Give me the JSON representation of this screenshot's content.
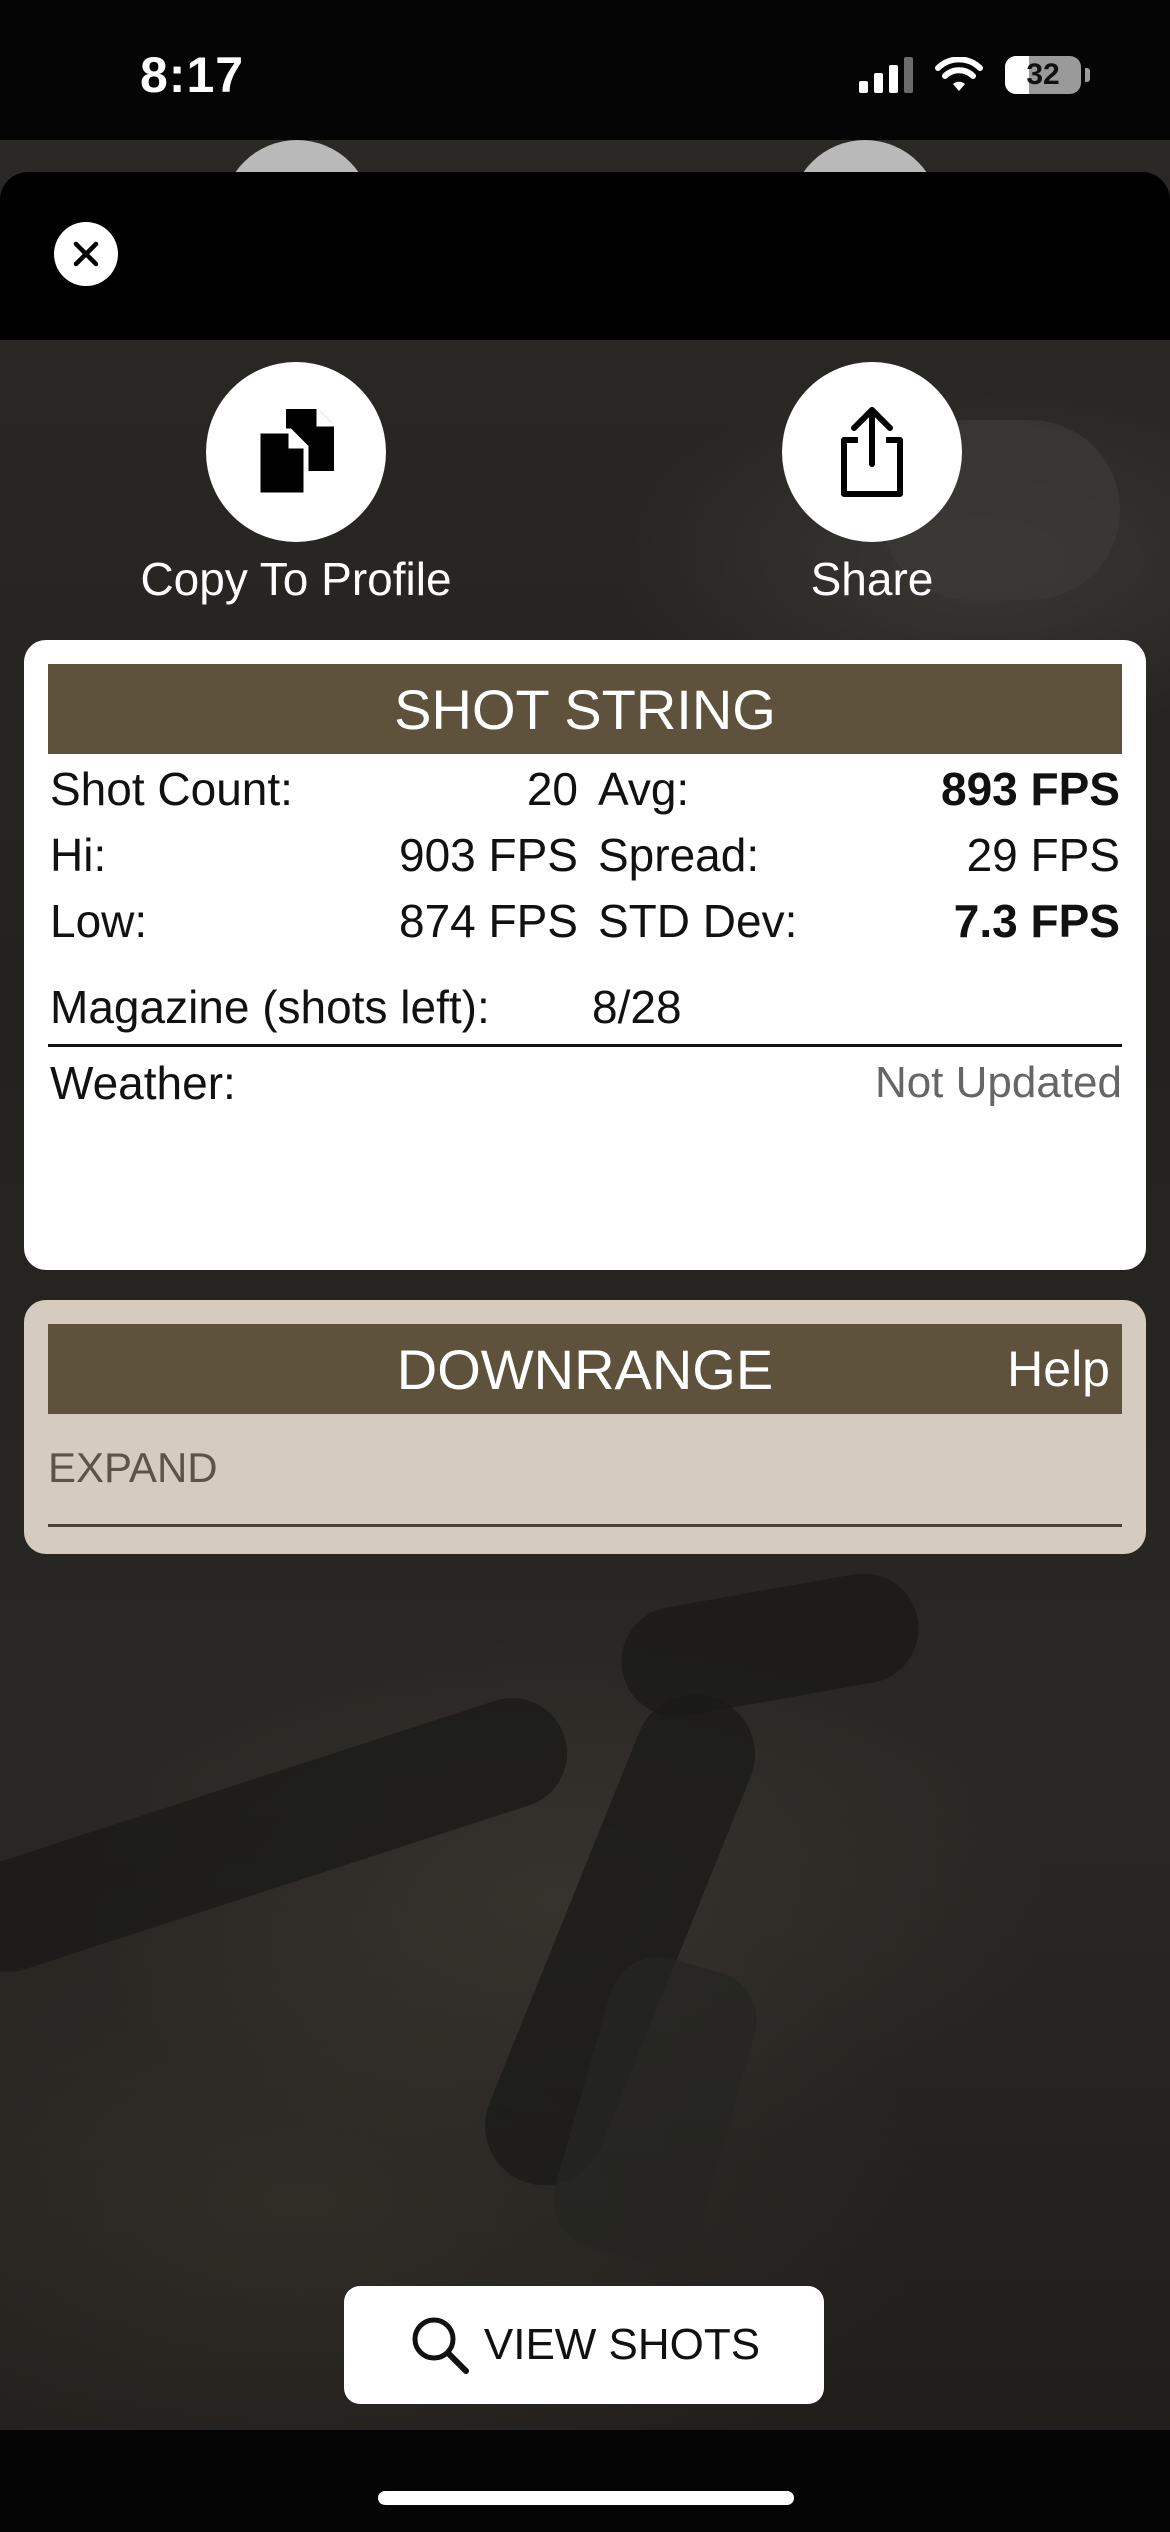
{
  "status_bar": {
    "time": "8:17",
    "battery": "32",
    "battery_level_percent": 32,
    "icons": [
      "cellular-signal-icon",
      "wifi-icon",
      "battery-icon"
    ]
  },
  "top_actions": {
    "close_icon": "close-icon",
    "copy_to_profile_label": "Copy To Profile",
    "copy_icon": "copy-documents-icon",
    "share_label": "Share",
    "share_icon": "share-icon"
  },
  "shot_string": {
    "title": "SHOT STRING",
    "shot_count_label": "Shot Count:",
    "shot_count_value": "20",
    "avg_label": "Avg:",
    "avg_value": "893 FPS",
    "hi_label": "Hi:",
    "hi_value": "903 FPS",
    "spread_label": "Spread:",
    "spread_value": "29 FPS",
    "low_label": "Low:",
    "low_value": "874 FPS",
    "std_dev_label": "STD Dev:",
    "std_dev_value": "7.3 FPS",
    "magazine_label": "Magazine (shots left):",
    "magazine_value": "8/28",
    "weather_label": "Weather:",
    "weather_value": "Not Updated"
  },
  "downrange": {
    "title": "DOWNRANGE",
    "help_label": "Help",
    "expand_label": "EXPAND"
  },
  "footer": {
    "view_shots_label": "VIEW SHOTS",
    "search_icon": "search-icon"
  },
  "colors": {
    "header_brown": "#5e523d",
    "downrange_bg": "#d6cbbf",
    "card_bg": "#ffffff"
  }
}
